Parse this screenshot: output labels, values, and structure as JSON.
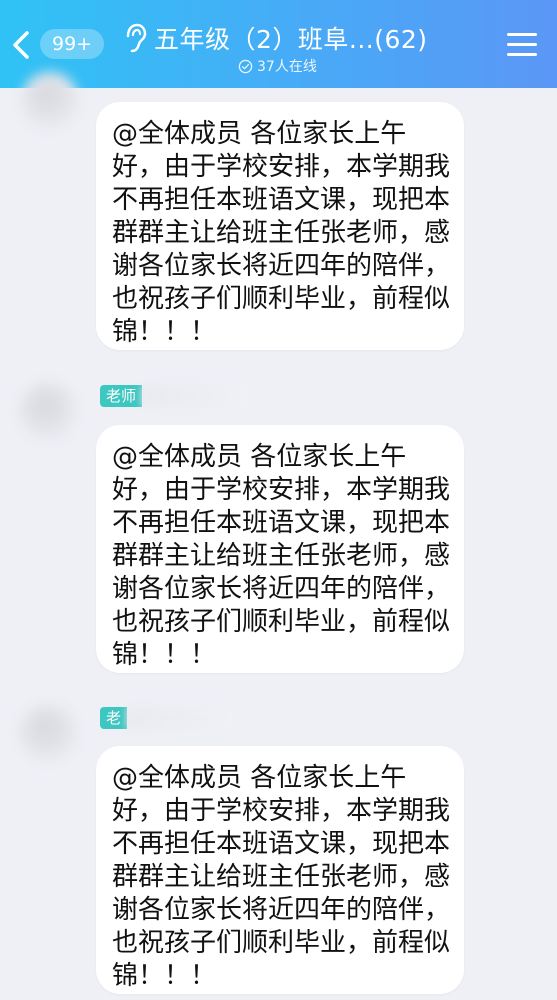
{
  "header": {
    "back_badge": "99+",
    "title": "五年级（2）班阜...(62)",
    "online": "37人在线"
  },
  "messages": [
    {
      "role_tag": "",
      "text": "@全体成员 各位家长上午好，由于学校安排，本学期我不再担任本班语文课，现把本群群主让给班主任张老师，感谢各位家长将近四年的陪伴，也祝孩子们顺利毕业，前程似锦！！！"
    },
    {
      "role_tag": "老师",
      "text": "@全体成员 各位家长上午好，由于学校安排，本学期我不再担任本班语文课，现把本群群主让给班主任张老师，感谢各位家长将近四年的陪伴，也祝孩子们顺利毕业，前程似锦！！！"
    },
    {
      "role_tag": "老",
      "text": "@全体成员 各位家长上午好，由于学校安排，本学期我不再担任本班语文课，现把本群群主让给班主任张老师，感谢各位家长将近四年的陪伴，也祝孩子们顺利毕业，前程似锦！！！"
    }
  ]
}
